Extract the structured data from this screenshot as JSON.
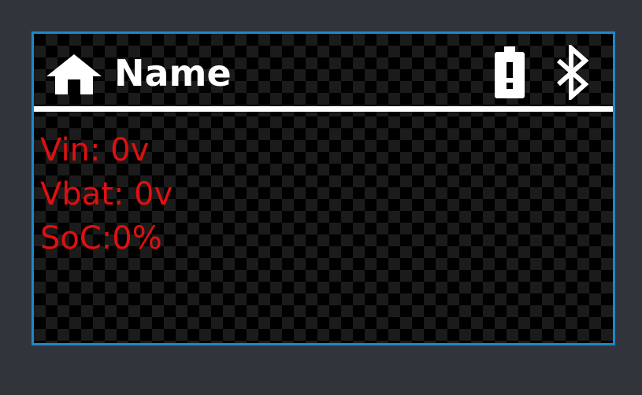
{
  "header": {
    "title": "Name",
    "icons": {
      "home": "home-icon",
      "battery": "battery-alert-icon",
      "bluetooth": "bluetooth-icon"
    }
  },
  "readings": {
    "vin": "Vin: 0v",
    "vbat": "Vbat: 0v",
    "soc": "SoC:0%"
  },
  "colors": {
    "background": "#31353b",
    "frame_border": "#1e88c8",
    "header_text": "#ffffff",
    "reading_text": "#e01010"
  }
}
